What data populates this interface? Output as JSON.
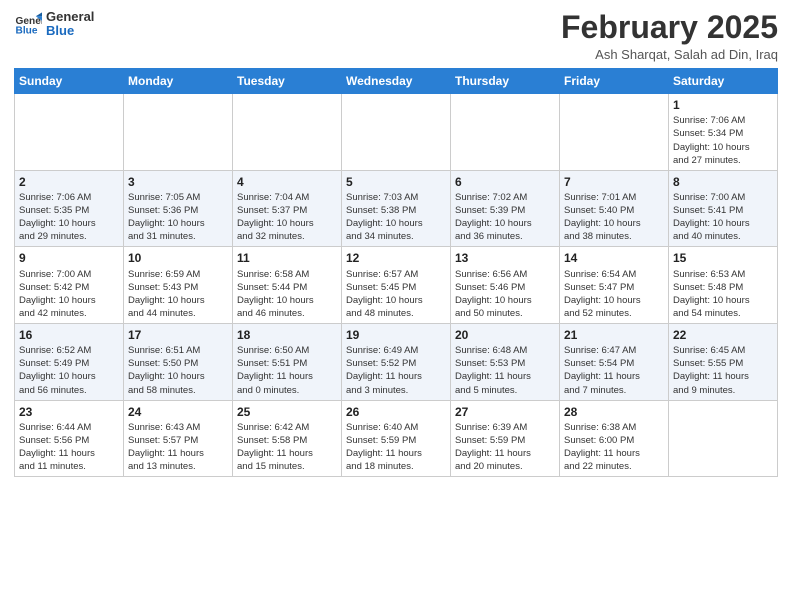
{
  "header": {
    "logo_line1": "General",
    "logo_line2": "Blue",
    "title": "February 2025",
    "subtitle": "Ash Sharqat, Salah ad Din, Iraq"
  },
  "weekdays": [
    "Sunday",
    "Monday",
    "Tuesday",
    "Wednesday",
    "Thursday",
    "Friday",
    "Saturday"
  ],
  "weeks": [
    [
      {
        "day": "",
        "info": ""
      },
      {
        "day": "",
        "info": ""
      },
      {
        "day": "",
        "info": ""
      },
      {
        "day": "",
        "info": ""
      },
      {
        "day": "",
        "info": ""
      },
      {
        "day": "",
        "info": ""
      },
      {
        "day": "1",
        "info": "Sunrise: 7:06 AM\nSunset: 5:34 PM\nDaylight: 10 hours\nand 27 minutes."
      }
    ],
    [
      {
        "day": "2",
        "info": "Sunrise: 7:06 AM\nSunset: 5:35 PM\nDaylight: 10 hours\nand 29 minutes."
      },
      {
        "day": "3",
        "info": "Sunrise: 7:05 AM\nSunset: 5:36 PM\nDaylight: 10 hours\nand 31 minutes."
      },
      {
        "day": "4",
        "info": "Sunrise: 7:04 AM\nSunset: 5:37 PM\nDaylight: 10 hours\nand 32 minutes."
      },
      {
        "day": "5",
        "info": "Sunrise: 7:03 AM\nSunset: 5:38 PM\nDaylight: 10 hours\nand 34 minutes."
      },
      {
        "day": "6",
        "info": "Sunrise: 7:02 AM\nSunset: 5:39 PM\nDaylight: 10 hours\nand 36 minutes."
      },
      {
        "day": "7",
        "info": "Sunrise: 7:01 AM\nSunset: 5:40 PM\nDaylight: 10 hours\nand 38 minutes."
      },
      {
        "day": "8",
        "info": "Sunrise: 7:00 AM\nSunset: 5:41 PM\nDaylight: 10 hours\nand 40 minutes."
      }
    ],
    [
      {
        "day": "9",
        "info": "Sunrise: 7:00 AM\nSunset: 5:42 PM\nDaylight: 10 hours\nand 42 minutes."
      },
      {
        "day": "10",
        "info": "Sunrise: 6:59 AM\nSunset: 5:43 PM\nDaylight: 10 hours\nand 44 minutes."
      },
      {
        "day": "11",
        "info": "Sunrise: 6:58 AM\nSunset: 5:44 PM\nDaylight: 10 hours\nand 46 minutes."
      },
      {
        "day": "12",
        "info": "Sunrise: 6:57 AM\nSunset: 5:45 PM\nDaylight: 10 hours\nand 48 minutes."
      },
      {
        "day": "13",
        "info": "Sunrise: 6:56 AM\nSunset: 5:46 PM\nDaylight: 10 hours\nand 50 minutes."
      },
      {
        "day": "14",
        "info": "Sunrise: 6:54 AM\nSunset: 5:47 PM\nDaylight: 10 hours\nand 52 minutes."
      },
      {
        "day": "15",
        "info": "Sunrise: 6:53 AM\nSunset: 5:48 PM\nDaylight: 10 hours\nand 54 minutes."
      }
    ],
    [
      {
        "day": "16",
        "info": "Sunrise: 6:52 AM\nSunset: 5:49 PM\nDaylight: 10 hours\nand 56 minutes."
      },
      {
        "day": "17",
        "info": "Sunrise: 6:51 AM\nSunset: 5:50 PM\nDaylight: 10 hours\nand 58 minutes."
      },
      {
        "day": "18",
        "info": "Sunrise: 6:50 AM\nSunset: 5:51 PM\nDaylight: 11 hours\nand 0 minutes."
      },
      {
        "day": "19",
        "info": "Sunrise: 6:49 AM\nSunset: 5:52 PM\nDaylight: 11 hours\nand 3 minutes."
      },
      {
        "day": "20",
        "info": "Sunrise: 6:48 AM\nSunset: 5:53 PM\nDaylight: 11 hours\nand 5 minutes."
      },
      {
        "day": "21",
        "info": "Sunrise: 6:47 AM\nSunset: 5:54 PM\nDaylight: 11 hours\nand 7 minutes."
      },
      {
        "day": "22",
        "info": "Sunrise: 6:45 AM\nSunset: 5:55 PM\nDaylight: 11 hours\nand 9 minutes."
      }
    ],
    [
      {
        "day": "23",
        "info": "Sunrise: 6:44 AM\nSunset: 5:56 PM\nDaylight: 11 hours\nand 11 minutes."
      },
      {
        "day": "24",
        "info": "Sunrise: 6:43 AM\nSunset: 5:57 PM\nDaylight: 11 hours\nand 13 minutes."
      },
      {
        "day": "25",
        "info": "Sunrise: 6:42 AM\nSunset: 5:58 PM\nDaylight: 11 hours\nand 15 minutes."
      },
      {
        "day": "26",
        "info": "Sunrise: 6:40 AM\nSunset: 5:59 PM\nDaylight: 11 hours\nand 18 minutes."
      },
      {
        "day": "27",
        "info": "Sunrise: 6:39 AM\nSunset: 5:59 PM\nDaylight: 11 hours\nand 20 minutes."
      },
      {
        "day": "28",
        "info": "Sunrise: 6:38 AM\nSunset: 6:00 PM\nDaylight: 11 hours\nand 22 minutes."
      },
      {
        "day": "",
        "info": ""
      }
    ]
  ]
}
